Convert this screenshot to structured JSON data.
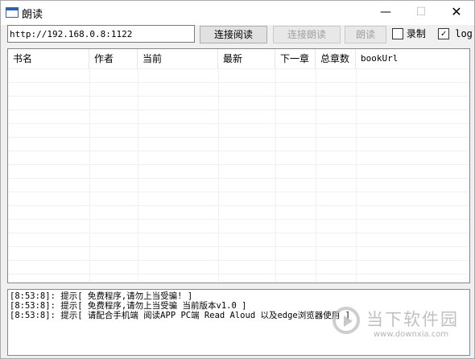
{
  "window": {
    "title": "朗读",
    "min_glyph": "—",
    "max_glyph": "☐",
    "close_glyph": "✕"
  },
  "toolbar": {
    "url_value": "http://192.168.0.8:1122",
    "connect_label": "连接阅读",
    "connect_read_label": "连接朗读",
    "read_label": "朗读",
    "record_label": "录制",
    "record_checked": false,
    "log_label": "log",
    "log_checked": true
  },
  "table": {
    "columns": [
      "书名",
      "作者",
      "当前",
      "最新",
      "下一章",
      "总章数",
      "bookUrl"
    ],
    "rows": []
  },
  "log": {
    "lines": [
      "[8:53:8]: 提示[ 免费程序,请勿上当受骗! ]",
      "[8:53:8]: 提示[ 免费程序,请勿上当受骗 当前版本v1.0 ]",
      "[8:53:8]: 提示[ 请配合手机端 阅读APP PC端 Read Aloud 以及edge浏览器使用 ]"
    ]
  },
  "watermark": {
    "text": "当下软件园",
    "url": "www.downxia.com"
  },
  "icons": {
    "app": "window-icon",
    "checkbox_checked": "check-icon"
  }
}
